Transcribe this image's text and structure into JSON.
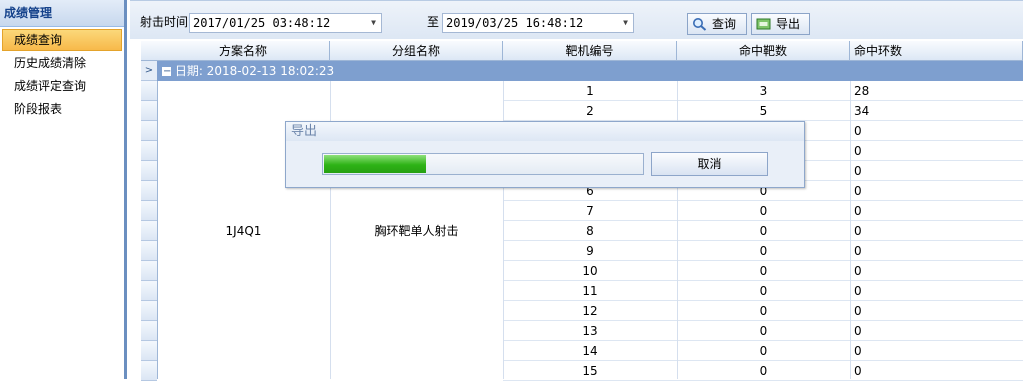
{
  "sidebar": {
    "header": "成绩管理",
    "items": [
      {
        "label": "成绩查询",
        "active": true
      },
      {
        "label": "历史成绩清除",
        "active": false
      },
      {
        "label": "成绩评定查询",
        "active": false
      },
      {
        "label": "阶段报表",
        "active": false
      }
    ]
  },
  "toolbar": {
    "shoot_time_label": "射击时间",
    "start_datetime": "2017/01/25 03:48:12",
    "to_label": "至",
    "end_datetime": "2019/03/25 16:48:12",
    "query_label": "查询",
    "export_label": "导出"
  },
  "table": {
    "columns": [
      "方案名称",
      "分组名称",
      "靶机编号",
      "命中靶数",
      "命中环数"
    ],
    "group_label": "日期: 2018-02-13 18:02:23",
    "scheme_name": "1J4Q1",
    "group_name": "胸环靶单人射击",
    "rows": [
      {
        "target": "1",
        "hits": "3",
        "rings": "28"
      },
      {
        "target": "2",
        "hits": "5",
        "rings": "34"
      },
      {
        "target": "",
        "hits": "",
        "rings": "0"
      },
      {
        "target": "",
        "hits": "",
        "rings": "0"
      },
      {
        "target": "",
        "hits": "",
        "rings": "0"
      },
      {
        "target": "6",
        "hits": "0",
        "rings": "0"
      },
      {
        "target": "7",
        "hits": "0",
        "rings": "0"
      },
      {
        "target": "8",
        "hits": "0",
        "rings": "0"
      },
      {
        "target": "9",
        "hits": "0",
        "rings": "0"
      },
      {
        "target": "10",
        "hits": "0",
        "rings": "0"
      },
      {
        "target": "11",
        "hits": "0",
        "rings": "0"
      },
      {
        "target": "12",
        "hits": "0",
        "rings": "0"
      },
      {
        "target": "13",
        "hits": "0",
        "rings": "0"
      },
      {
        "target": "14",
        "hits": "0",
        "rings": "0"
      },
      {
        "target": "15",
        "hits": "0",
        "rings": "0"
      }
    ]
  },
  "dialog": {
    "title": "导出",
    "progress": 0.32,
    "cancel_label": "取消"
  },
  "colors": {
    "accent": "#7e9fcf",
    "active_item": "#f7b94a",
    "progress_fill": "#2eb316"
  }
}
